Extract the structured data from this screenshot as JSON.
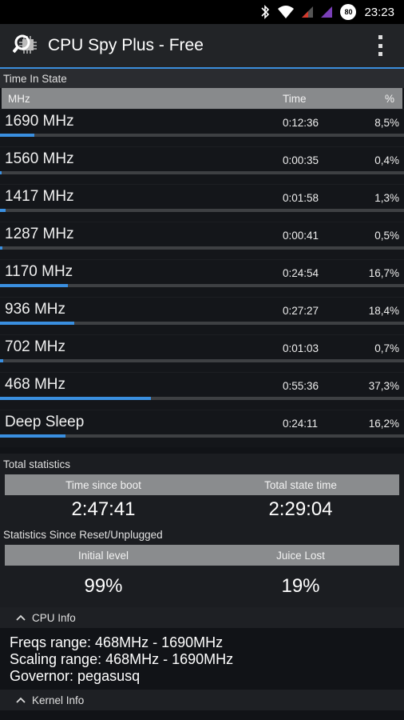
{
  "status_bar": {
    "battery_level": "80",
    "time": "23:23"
  },
  "app": {
    "title": "CPU Spy Plus - Free"
  },
  "time_in_state": {
    "section_title": "Time In State",
    "columns": {
      "mhz": "MHz",
      "time": "Time",
      "percent": "%"
    },
    "rows": [
      {
        "freq": "1690 MHz",
        "time": "0:12:36",
        "percent": "8,5%",
        "fraction": 0.085
      },
      {
        "freq": "1560 MHz",
        "time": "0:00:35",
        "percent": "0,4%",
        "fraction": 0.004
      },
      {
        "freq": "1417 MHz",
        "time": "0:01:58",
        "percent": "1,3%",
        "fraction": 0.013
      },
      {
        "freq": "1287 MHz",
        "time": "0:00:41",
        "percent": "0,5%",
        "fraction": 0.005
      },
      {
        "freq": "1170 MHz",
        "time": "0:24:54",
        "percent": "16,7%",
        "fraction": 0.167
      },
      {
        "freq": "936 MHz",
        "time": "0:27:27",
        "percent": "18,4%",
        "fraction": 0.184
      },
      {
        "freq": "702 MHz",
        "time": "0:01:03",
        "percent": "0,7%",
        "fraction": 0.007
      },
      {
        "freq": "468 MHz",
        "time": "0:55:36",
        "percent": "37,3%",
        "fraction": 0.373
      },
      {
        "freq": "Deep Sleep",
        "time": "0:24:11",
        "percent": "16,2%",
        "fraction": 0.162
      }
    ]
  },
  "total_statistics": {
    "label": "Total statistics",
    "headers": {
      "left": "Time since boot",
      "right": "Total state time"
    },
    "values": {
      "left": "2:47:41",
      "right": "2:29:04"
    }
  },
  "reset_statistics": {
    "label": "Statistics Since Reset/Unplugged",
    "headers": {
      "left": "Initial level",
      "right": "Juice Lost"
    },
    "values": {
      "left": "99%",
      "right": "19%"
    }
  },
  "cpu_info": {
    "title": "CPU Info",
    "lines": [
      "Freqs range: 468MHz - 1690MHz",
      "Scaling range: 468MHz - 1690MHz",
      "Governor: pegasusq"
    ]
  },
  "kernel_info": {
    "title": "Kernel Info"
  },
  "colors": {
    "accent": "#3a8fe0",
    "bar_track": "#3e4043",
    "header_gray": "#888a8c"
  }
}
